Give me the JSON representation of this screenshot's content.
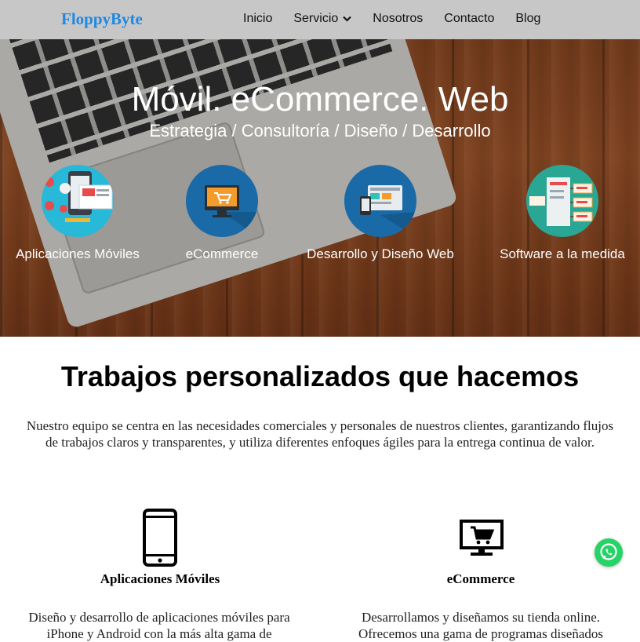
{
  "brand": "FloppyByte",
  "nav": {
    "items": [
      {
        "label": "Inicio"
      },
      {
        "label": "Servicio"
      },
      {
        "label": "Nosotros"
      },
      {
        "label": "Contacto"
      },
      {
        "label": "Blog"
      }
    ]
  },
  "hero": {
    "title": "Móvil. eCommerce. Web",
    "subtitle": "Estrategia / Consultoría / Diseño / Desarrollo",
    "services": [
      {
        "label": "Aplicaciones Móviles",
        "icon": "mobile-apps-icon"
      },
      {
        "label": "eCommerce",
        "icon": "ecommerce-monitor-icon"
      },
      {
        "label": "Desarrollo y Diseño Web",
        "icon": "web-design-devices-icon"
      },
      {
        "label": "Software a la medida",
        "icon": "custom-software-icon"
      }
    ]
  },
  "section": {
    "title": "Trabajos personalizados que hacemos",
    "intro": "Nuestro equipo se centra en las necesidades comerciales y personales de nuestros clientes, garantizando flujos de trabajos claros y transparentes, y utiliza diferentes enfoques ágiles para la entrega continua de valor."
  },
  "features": [
    {
      "title": "Aplicaciones Móviles",
      "text": "Diseño y desarrollo de aplicaciones móviles para iPhone y Android con la más alta gama de",
      "icon": "smartphone-icon"
    },
    {
      "title": "eCommerce",
      "text": "Desarrollamos y diseñamos su tienda online. Ofrecemos una gama de programas diseñados",
      "icon": "monitor-cart-icon"
    }
  ],
  "colors": {
    "brand": "#1e88e5",
    "nav_bg": "#c7c7c7",
    "whatsapp": "#25d366"
  }
}
